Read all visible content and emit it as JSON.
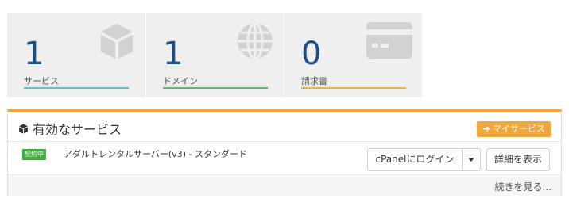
{
  "stats": [
    {
      "count": "1",
      "label": "サービス",
      "color": "#5bc0de",
      "icon": "cube-icon"
    },
    {
      "count": "1",
      "label": "ドメイン",
      "color": "#5cb85c",
      "icon": "globe-icon"
    },
    {
      "count": "0",
      "label": "請求書",
      "color": "#f0ad4e",
      "icon": "credit-card-icon"
    }
  ],
  "panel": {
    "title": "有効なサービス",
    "my_services_label": "➔ マイサービス",
    "accent": "#f0a73b",
    "service": {
      "status_badge": "契約中",
      "name": "アダルトレンタルサーバー(v3) - スタンダード",
      "cpanel_login_label": "cPanelにログイン",
      "details_label": "詳細を表示"
    },
    "more_label": "続きを見る..."
  }
}
